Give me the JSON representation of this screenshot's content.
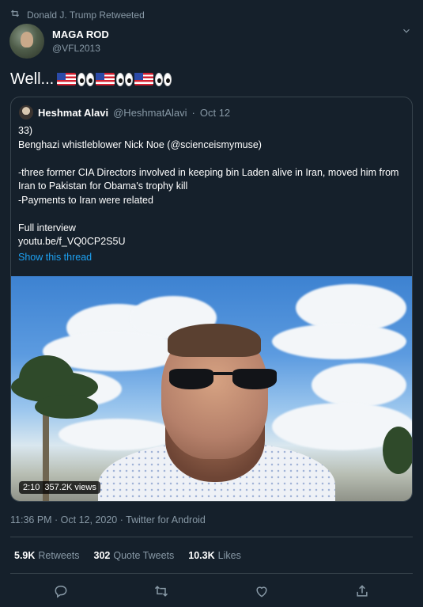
{
  "retweet_banner": {
    "text": "Donald J. Trump Retweeted"
  },
  "author": {
    "display_name": "MAGA ROD",
    "handle": "@VFL2013"
  },
  "tweet": {
    "text": "Well..."
  },
  "quoted": {
    "display_name": "Heshmat Alavi",
    "handle": "@HeshmatAlavi",
    "separator": "·",
    "date": "Oct 12",
    "lines": [
      "33)",
      "Benghazi whistleblower Nick Noe (@scienceismymuse)",
      "",
      "-three former CIA Directors involved in keeping bin Laden alive in Iran, moved him from Iran to Pakistan for Obama's trophy kill",
      "-Payments to Iran were related",
      "",
      "Full interview",
      "youtu.be/f_VQ0CP2S5U"
    ],
    "show_thread": "Show this thread",
    "video": {
      "duration": "2:10",
      "views": "357.2K views"
    }
  },
  "meta": {
    "text": "11:36 PM · Oct 12, 2020 · Twitter for Android"
  },
  "stats": {
    "retweets_count": "5.9K",
    "retweets_label": "Retweets",
    "quotes_count": "302",
    "quotes_label": "Quote Tweets",
    "likes_count": "10.3K",
    "likes_label": "Likes"
  },
  "colors": {
    "background": "#15202b",
    "link": "#1da1f2",
    "muted": "#8899a6",
    "border": "#38444d"
  },
  "icons": [
    "retweet-icon",
    "chevron-down-icon",
    "reply-icon",
    "like-icon",
    "share-icon"
  ]
}
